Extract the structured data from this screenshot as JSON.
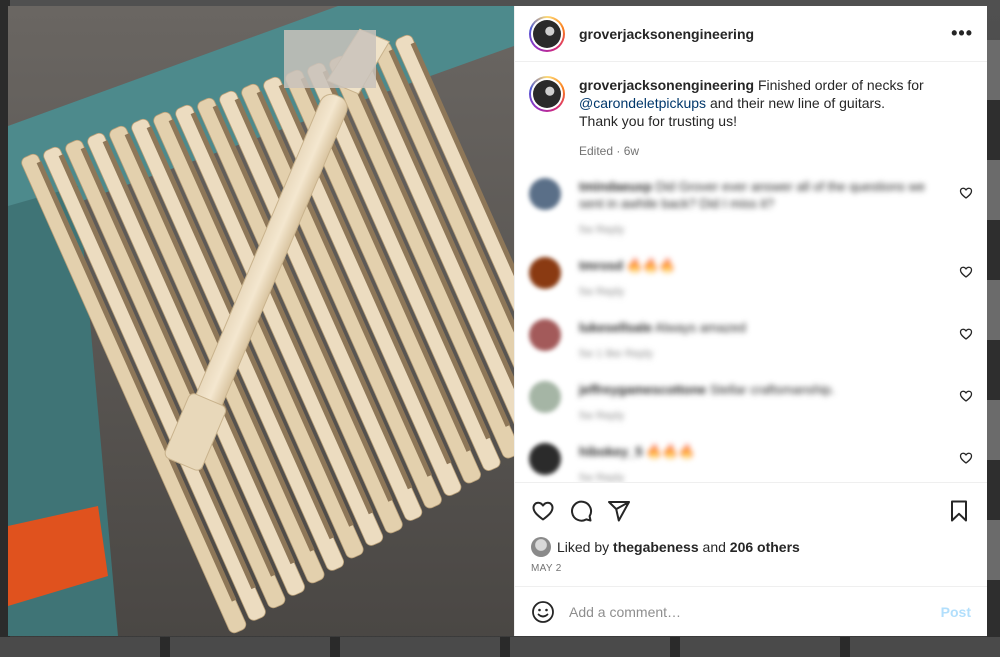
{
  "post": {
    "username": "groverjacksonengineering",
    "more_label": "•••"
  },
  "caption": {
    "username": "groverjacksonengineering",
    "text_before": " Finished order of necks for ",
    "mention": "@carondeletpickups",
    "text_after": " and their new line of guitars.",
    "line2": "Thank you for trusting us!",
    "meta": "Edited · 6w"
  },
  "comments": [
    {
      "user": "tmindaeuxp",
      "text": "Did Grover ever answer all of the questions we sent in awhile back? Did I miss it?",
      "meta": "5w   Reply",
      "avatar_color": "#5a6f88"
    },
    {
      "user": "tmrosd",
      "text": "🔥🔥🔥",
      "meta": "5w   Reply",
      "avatar_color": "#8a3a12"
    },
    {
      "user": "lukesellsale",
      "text": "Always amazed",
      "meta": "5w   1 like   Reply",
      "avatar_color": "#a35a5a"
    },
    {
      "user": "jeffreygamescottone",
      "text": "Stellar craftsmanship.",
      "meta": "5w   Reply",
      "avatar_color": "#a5b5a5"
    },
    {
      "user": "hibokey_5",
      "text": "🔥🔥🔥",
      "meta": "5w   Reply",
      "avatar_color": "#2b2b2b"
    }
  ],
  "likes": {
    "prefix": "Liked by ",
    "user": "thegabeness",
    "middle": " and ",
    "count": "206 others"
  },
  "date": "MAY 2",
  "add_comment": {
    "placeholder": "Add a comment…",
    "post_label": "Post"
  },
  "icons": {
    "like": "heart-icon",
    "comment": "comment-icon",
    "share": "share-icon",
    "save": "bookmark-icon",
    "emoji": "emoji-icon"
  },
  "colors": {
    "mention": "#00376b",
    "post_disabled": "#b2dffc",
    "meta": "#737373"
  }
}
